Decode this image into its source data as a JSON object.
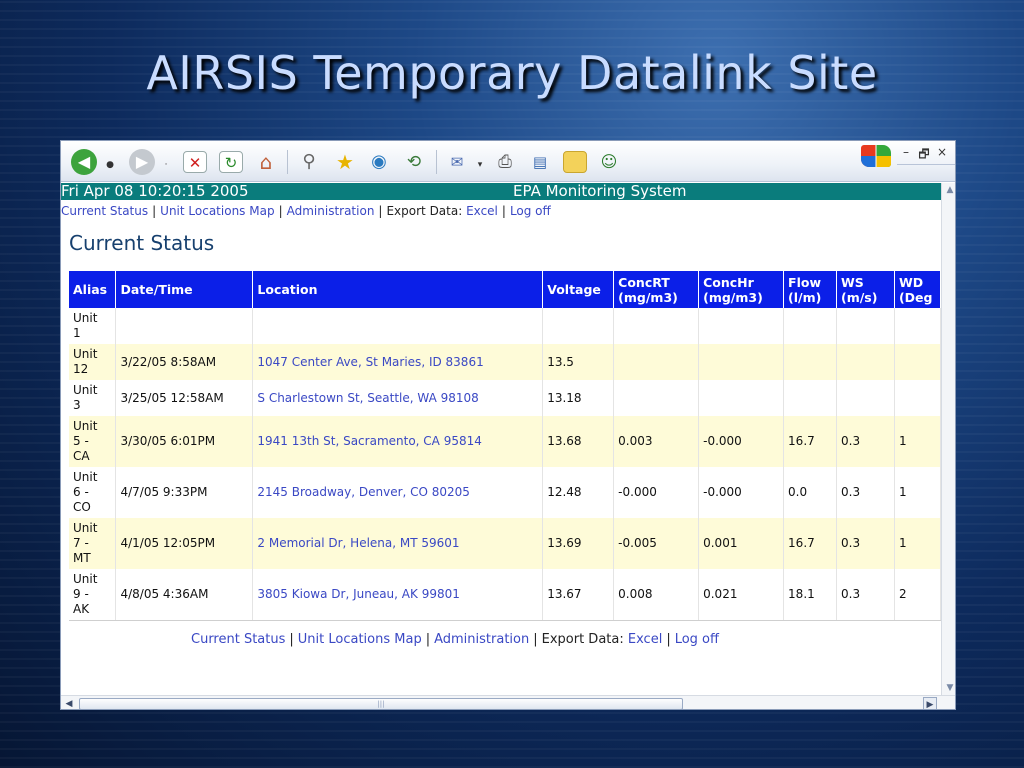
{
  "slide": {
    "title": "AIRSIS Temporary Datalink Site"
  },
  "browser": {
    "window_controls": {
      "minimize": "–",
      "restore": "🗗",
      "close": "×"
    },
    "icons": [
      "back-icon",
      "forward-icon",
      "stop-icon",
      "refresh-icon",
      "home-icon",
      "search-icon",
      "favorites-icon",
      "media-icon",
      "history-icon",
      "mail-icon",
      "print-icon",
      "edit-icon",
      "discuss-icon",
      "messenger-icon",
      "windows-logo-icon"
    ]
  },
  "header": {
    "datetime": "Fri Apr 08 10:20:15 2005",
    "system": "EPA Monitoring System"
  },
  "nav": {
    "current_status": "Current Status",
    "unit_locations_map": "Unit Locations Map",
    "administration": "Administration",
    "export_data": "Export Data:",
    "excel": "Excel",
    "log_off": "Log off",
    "separator": "|"
  },
  "page": {
    "heading": "Current Status"
  },
  "table": {
    "columns": [
      {
        "line1": "Alias",
        "line2": ""
      },
      {
        "line1": "Date/Time",
        "line2": ""
      },
      {
        "line1": "Location",
        "line2": ""
      },
      {
        "line1": "Voltage",
        "line2": ""
      },
      {
        "line1": "ConcRT",
        "line2": "(mg/m3)"
      },
      {
        "line1": "ConcHr",
        "line2": "(mg/m3)"
      },
      {
        "line1": "Flow",
        "line2": "(l/m)"
      },
      {
        "line1": "WS",
        "line2": "(m/s)"
      },
      {
        "line1": "WD",
        "line2": "(Deg"
      }
    ],
    "rows": [
      {
        "alias": [
          "Unit",
          "1"
        ],
        "datetime": "",
        "location": "",
        "voltage": "",
        "conc_rt": "",
        "conc_hr": "",
        "flow": "",
        "ws": "",
        "wd": ""
      },
      {
        "alias": [
          "Unit",
          "12"
        ],
        "datetime": "3/22/05 8:58AM",
        "location": "1047 Center Ave, St Maries, ID 83861",
        "voltage": "13.5",
        "conc_rt": "",
        "conc_hr": "",
        "flow": "",
        "ws": "",
        "wd": ""
      },
      {
        "alias": [
          "Unit",
          "3"
        ],
        "datetime": "3/25/05 12:58AM",
        "location": "S Charlestown St, Seattle, WA 98108",
        "voltage": "13.18",
        "conc_rt": "",
        "conc_hr": "",
        "flow": "",
        "ws": "",
        "wd": ""
      },
      {
        "alias": [
          "Unit",
          "5 -",
          "CA"
        ],
        "datetime": "3/30/05 6:01PM",
        "location": "1941 13th St, Sacramento, CA 95814",
        "voltage": "13.68",
        "conc_rt": "0.003",
        "conc_hr": "-0.000",
        "flow": "16.7",
        "ws": "0.3",
        "wd": "1"
      },
      {
        "alias": [
          "Unit",
          "6 -",
          "CO"
        ],
        "datetime": "4/7/05 9:33PM",
        "location": "2145 Broadway, Denver, CO 80205",
        "voltage": "12.48",
        "conc_rt": "-0.000",
        "conc_hr": "-0.000",
        "flow": "0.0",
        "ws": "0.3",
        "wd": "1"
      },
      {
        "alias": [
          "Unit",
          "7 -",
          "MT"
        ],
        "datetime": "4/1/05 12:05PM",
        "location": "2 Memorial Dr, Helena, MT 59601",
        "voltage": "13.69",
        "conc_rt": "-0.005",
        "conc_hr": "0.001",
        "flow": "16.7",
        "ws": "0.3",
        "wd": "1"
      },
      {
        "alias": [
          "Unit",
          "9 -",
          "AK"
        ],
        "datetime": "4/8/05 4:36AM",
        "location": "3805 Kiowa Dr, Juneau, AK 99801",
        "voltage": "13.67",
        "conc_rt": "0.008",
        "conc_hr": "0.021",
        "flow": "18.1",
        "ws": "0.3",
        "wd": "2"
      }
    ]
  },
  "scrollbars": {
    "up": "▲",
    "down": "▼",
    "left": "◀",
    "right": "▶",
    "grip": "|||"
  },
  "colors": {
    "header_bar": "#0a7c7c",
    "table_header": "#0b1fe8",
    "link": "#3a48c4",
    "row_alt": "#fefbd8",
    "heading": "#17406e"
  }
}
